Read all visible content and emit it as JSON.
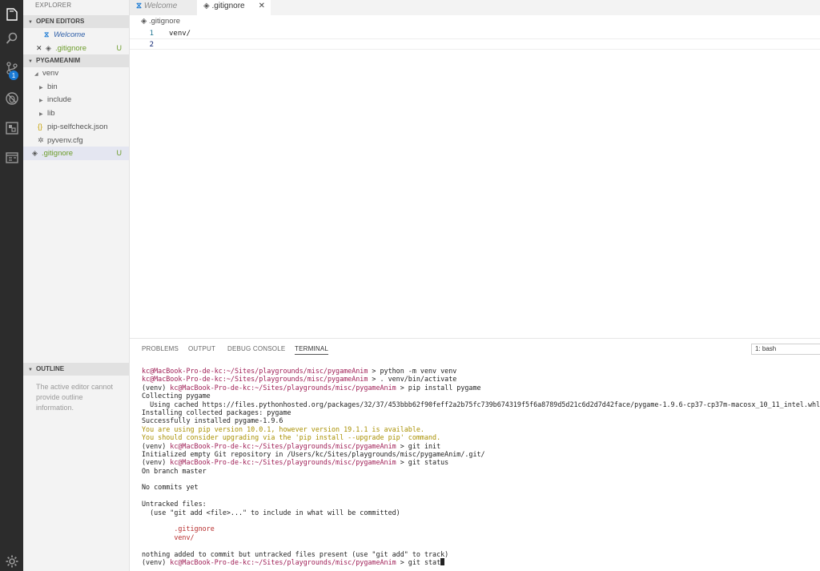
{
  "sidebar": {
    "title": "EXPLORER",
    "open_editors": {
      "header": "OPEN EDITORS",
      "items": [
        {
          "label": "Welcome",
          "badge": ""
        },
        {
          "label": ".gitignore",
          "badge": "U"
        }
      ]
    },
    "project": {
      "header": "PYGAMEANIM",
      "items": [
        {
          "label": "venv"
        },
        {
          "label": "bin"
        },
        {
          "label": "include"
        },
        {
          "label": "lib"
        },
        {
          "label": "pip-selfcheck.json"
        },
        {
          "label": "pyvenv.cfg"
        },
        {
          "label": ".gitignore",
          "badge": "U"
        }
      ]
    },
    "outline": {
      "header": "OUTLINE",
      "message": "The active editor cannot provide outline information."
    }
  },
  "activity": {
    "scm_badge": "1",
    "icons": [
      "explorer-icon",
      "search-icon",
      "source-control-icon",
      "debug-icon",
      "extensions-icon",
      "remote-explorer-icon",
      "gear-icon"
    ]
  },
  "tabs": [
    {
      "label": "Welcome"
    },
    {
      "label": ".gitignore"
    }
  ],
  "editor": {
    "breadcrumb": ".gitignore",
    "lines": [
      {
        "num": "1",
        "text": "venv/"
      },
      {
        "num": "2",
        "text": ""
      }
    ]
  },
  "panel": {
    "tabs": [
      "PROBLEMS",
      "OUTPUT",
      "DEBUG CONSOLE",
      "TERMINAL"
    ],
    "terminal_select": "1: bash",
    "terminal_lines": [
      {
        "prefix": "",
        "prompt": "kc@MacBook-Pro-de-kc:~/Sites/playgrounds/misc/pygameAnim",
        "text": " > python -m venv venv",
        "style": ""
      },
      {
        "prefix": "",
        "prompt": "kc@MacBook-Pro-de-kc:~/Sites/playgrounds/misc/pygameAnim",
        "text": " > . venv/bin/activate",
        "style": ""
      },
      {
        "prefix": "(venv) ",
        "prompt": "kc@MacBook-Pro-de-kc:~/Sites/playgrounds/misc/pygameAnim",
        "text": " > pip install pygame",
        "style": ""
      },
      {
        "prefix": "",
        "prompt": "",
        "text": "Collecting pygame",
        "style": ""
      },
      {
        "prefix": "",
        "prompt": "",
        "text": "  Using cached https://files.pythonhosted.org/packages/32/37/453bbb62f90feff2a2b75fc739b674319f5f6a8789d5d21c6d2d7d42face/pygame-1.9.6-cp37-cp37m-macosx_10_11_intel.whl",
        "style": ""
      },
      {
        "prefix": "",
        "prompt": "",
        "text": "Installing collected packages: pygame",
        "style": ""
      },
      {
        "prefix": "",
        "prompt": "",
        "text": "Successfully installed pygame-1.9.6",
        "style": ""
      },
      {
        "prefix": "",
        "prompt": "",
        "text": "You are using pip version 10.0.1, however version 19.1.1 is available.",
        "style": "ylw"
      },
      {
        "prefix": "",
        "prompt": "",
        "text": "You should consider upgrading via the 'pip install --upgrade pip' command.",
        "style": "ylw"
      },
      {
        "prefix": "(venv) ",
        "prompt": "kc@MacBook-Pro-de-kc:~/Sites/playgrounds/misc/pygameAnim",
        "text": " > git init",
        "style": ""
      },
      {
        "prefix": "",
        "prompt": "",
        "text": "Initialized empty Git repository in /Users/kc/Sites/playgrounds/misc/pygameAnim/.git/",
        "style": ""
      },
      {
        "prefix": "(venv) ",
        "prompt": "kc@MacBook-Pro-de-kc:~/Sites/playgrounds/misc/pygameAnim",
        "text": " > git status",
        "style": ""
      },
      {
        "prefix": "",
        "prompt": "",
        "text": "On branch master",
        "style": ""
      },
      {
        "prefix": "",
        "prompt": "",
        "text": "",
        "style": ""
      },
      {
        "prefix": "",
        "prompt": "",
        "text": "No commits yet",
        "style": ""
      },
      {
        "prefix": "",
        "prompt": "",
        "text": "",
        "style": ""
      },
      {
        "prefix": "",
        "prompt": "",
        "text": "Untracked files:",
        "style": ""
      },
      {
        "prefix": "",
        "prompt": "",
        "text": "  (use \"git add <file>...\" to include in what will be committed)",
        "style": ""
      },
      {
        "prefix": "",
        "prompt": "",
        "text": "",
        "style": ""
      },
      {
        "prefix": "",
        "prompt": "",
        "text": "        .gitignore",
        "style": "red"
      },
      {
        "prefix": "",
        "prompt": "",
        "text": "        venv/",
        "style": "red"
      },
      {
        "prefix": "",
        "prompt": "",
        "text": "",
        "style": ""
      },
      {
        "prefix": "",
        "prompt": "",
        "text": "nothing added to commit but untracked files present (use \"git add\" to track)",
        "style": ""
      },
      {
        "prefix": "(venv) ",
        "prompt": "kc@MacBook-Pro-de-kc:~/Sites/playgrounds/misc/pygameAnim",
        "text": " > git stat",
        "style": "",
        "cursor": true
      }
    ]
  }
}
